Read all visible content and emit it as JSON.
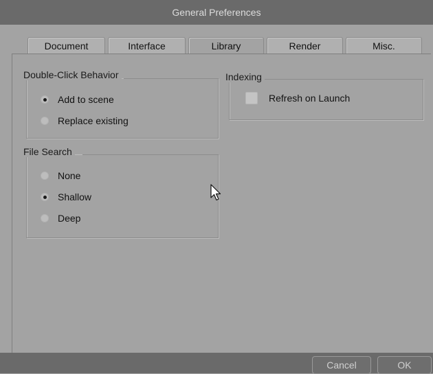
{
  "window": {
    "title": "General Preferences"
  },
  "tabs": [
    {
      "label": "Document",
      "active": false
    },
    {
      "label": "Interface",
      "active": false
    },
    {
      "label": "Library",
      "active": true
    },
    {
      "label": "Render",
      "active": false
    },
    {
      "label": "Misc.",
      "active": false
    }
  ],
  "double_click": {
    "label": "Double-Click Behavior",
    "options": [
      {
        "label": "Add to scene",
        "selected": true
      },
      {
        "label": "Replace existing",
        "selected": false
      }
    ]
  },
  "indexing": {
    "label": "Indexing",
    "refresh_on_launch": {
      "label": "Refresh on Launch",
      "checked": false
    }
  },
  "file_search": {
    "label": "File Search",
    "options": [
      {
        "label": "None",
        "selected": false
      },
      {
        "label": "Shallow",
        "selected": true
      },
      {
        "label": "Deep",
        "selected": false
      }
    ]
  },
  "buttons": {
    "cancel": "Cancel",
    "ok": "OK"
  },
  "colors": {
    "background": "#a3a3a3",
    "titlebar": "#6a6a6a"
  }
}
